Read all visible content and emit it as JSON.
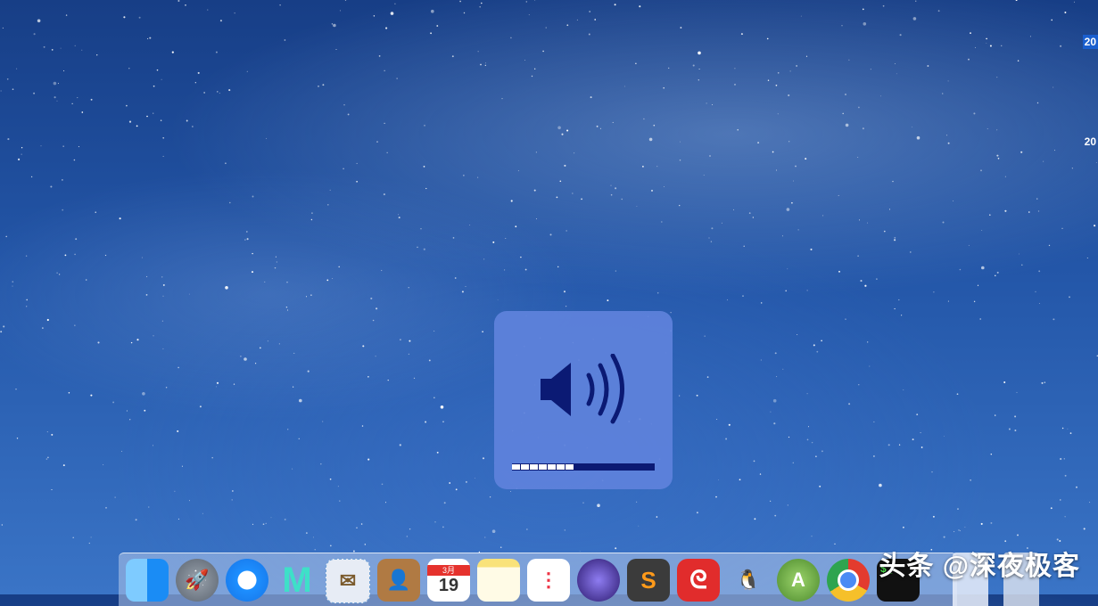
{
  "desktop": {
    "labels": [
      "20",
      "20"
    ]
  },
  "volume_hud": {
    "icon": "speaker-volume-icon",
    "level": 0.4375,
    "segments_total": 16,
    "segments_filled": 7
  },
  "dock": {
    "items": [
      {
        "name": "finder",
        "icon": "finder-icon",
        "label": ""
      },
      {
        "name": "launchpad",
        "icon": "rocket-icon",
        "label": "🚀"
      },
      {
        "name": "safari",
        "icon": "compass-icon",
        "label": ""
      },
      {
        "name": "mweb",
        "icon": "mweb-icon",
        "label": "M"
      },
      {
        "name": "mail",
        "icon": "mail-stamp-icon",
        "label": "✉"
      },
      {
        "name": "contacts",
        "icon": "contacts-book-icon",
        "label": "👤"
      },
      {
        "name": "calendar",
        "icon": "calendar-icon",
        "label": "19",
        "month": "3月"
      },
      {
        "name": "notes",
        "icon": "notes-icon",
        "label": ""
      },
      {
        "name": "reminders",
        "icon": "reminders-icon",
        "label": "⋮"
      },
      {
        "name": "eclipse",
        "icon": "eclipse-icon",
        "label": ""
      },
      {
        "name": "sublime",
        "icon": "sublime-text-icon",
        "label": "S"
      },
      {
        "name": "netease-music",
        "icon": "netease-music-icon",
        "label": "ᘓ"
      },
      {
        "name": "qq",
        "icon": "qq-penguin-icon",
        "label": "🐧"
      },
      {
        "name": "android-studio",
        "icon": "android-studio-icon",
        "label": "A"
      },
      {
        "name": "chrome",
        "icon": "chrome-icon",
        "label": ""
      },
      {
        "name": "terminal",
        "icon": "terminal-icon",
        "label": "$_"
      }
    ]
  },
  "watermark": "头条 @深夜极客"
}
